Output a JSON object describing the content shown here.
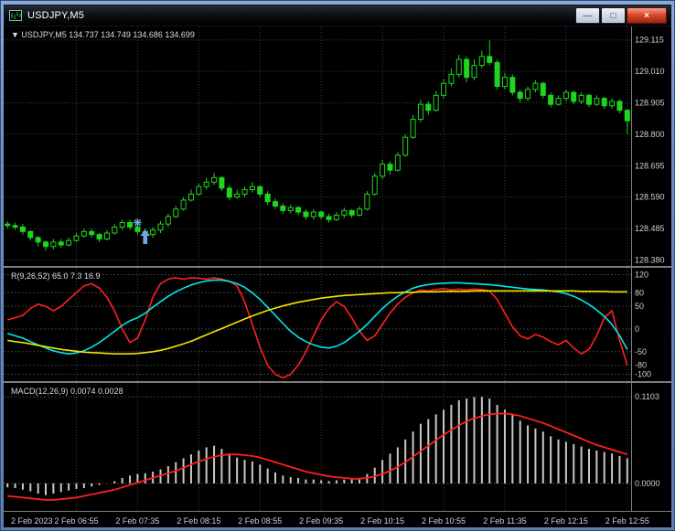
{
  "window": {
    "title": "USDJPY,M5",
    "buttons": [
      {
        "name": "Minimize",
        "glyph": "—"
      },
      {
        "name": "Maximize",
        "glyph": "□"
      },
      {
        "name": "Close",
        "glyph": "×"
      }
    ]
  },
  "colors": {
    "bg": "#000000",
    "grid": "#2d4444",
    "level": "#3c3c3c",
    "text": "#cfcfcf",
    "separator": "#808080",
    "candle": "#1fd51f"
  },
  "chart_data": [
    {
      "type": "candlestick",
      "symbol": "USDJPY",
      "timeframe": "M5",
      "header": "▼ USDJPY,M5 134.737 134.749 134.686 134.699",
      "price_axis": [
        "129.115",
        "129.010",
        "128.905",
        "128.800",
        "128.695",
        "128.590",
        "128.485",
        "128.380"
      ],
      "y_range": [
        128.36,
        129.16
      ],
      "annotation_color": "#6fa8dc",
      "annotations": [
        {
          "type": "star",
          "bar": 17,
          "price": 128.505
        },
        {
          "type": "arrow-up",
          "bar": 18,
          "price": 128.482
        }
      ],
      "candles": [
        [
          128.5,
          128.51,
          128.485,
          128.495
        ],
        [
          128.495,
          128.505,
          128.48,
          128.49
        ],
        [
          128.49,
          128.5,
          128.465,
          128.475
        ],
        [
          128.475,
          128.48,
          128.445,
          128.455
        ],
        [
          128.455,
          128.46,
          128.425,
          128.44
        ],
        [
          128.44,
          128.445,
          128.41,
          128.425
        ],
        [
          128.425,
          128.45,
          128.415,
          128.44
        ],
        [
          128.44,
          128.45,
          128.42,
          128.43
        ],
        [
          128.43,
          128.455,
          128.425,
          128.445
        ],
        [
          128.445,
          128.47,
          128.44,
          128.46
        ],
        [
          128.46,
          128.485,
          128.455,
          128.475
        ],
        [
          128.475,
          128.485,
          128.455,
          128.465
        ],
        [
          128.465,
          128.47,
          128.44,
          128.45
        ],
        [
          128.45,
          128.48,
          128.445,
          128.47
        ],
        [
          128.47,
          128.5,
          128.465,
          128.49
        ],
        [
          128.49,
          128.515,
          128.48,
          128.505
        ],
        [
          128.505,
          128.515,
          128.48,
          128.49
        ],
        [
          128.49,
          128.5,
          128.465,
          128.475
        ],
        [
          128.475,
          128.485,
          128.45,
          128.465
        ],
        [
          128.465,
          128.49,
          128.455,
          128.48
        ],
        [
          128.48,
          128.51,
          128.47,
          128.5
        ],
        [
          128.5,
          128.535,
          128.49,
          128.525
        ],
        [
          128.525,
          128.56,
          128.52,
          128.55
        ],
        [
          128.55,
          128.59,
          128.545,
          128.58
        ],
        [
          128.58,
          128.615,
          128.575,
          128.6
        ],
        [
          128.6,
          128.635,
          128.595,
          128.625
        ],
        [
          128.625,
          128.655,
          128.615,
          128.64
        ],
        [
          128.64,
          128.67,
          128.63,
          128.655
        ],
        [
          128.655,
          128.66,
          128.61,
          128.62
        ],
        [
          128.62,
          128.63,
          128.58,
          128.59
        ],
        [
          128.59,
          128.615,
          128.585,
          128.6
        ],
        [
          128.6,
          128.625,
          128.59,
          128.615
        ],
        [
          128.615,
          128.64,
          128.605,
          128.625
        ],
        [
          128.625,
          128.63,
          128.59,
          128.6
        ],
        [
          128.6,
          128.61,
          128.565,
          128.575
        ],
        [
          128.575,
          128.585,
          128.55,
          128.56
        ],
        [
          128.56,
          128.57,
          128.535,
          128.545
        ],
        [
          128.545,
          128.565,
          128.535,
          128.555
        ],
        [
          128.555,
          128.56,
          128.53,
          128.54
        ],
        [
          128.54,
          128.55,
          128.515,
          128.525
        ],
        [
          128.525,
          128.55,
          128.515,
          128.54
        ],
        [
          128.54,
          128.545,
          128.515,
          128.525
        ],
        [
          128.525,
          128.535,
          128.505,
          128.515
        ],
        [
          128.515,
          128.54,
          128.51,
          128.53
        ],
        [
          128.53,
          128.555,
          128.52,
          128.545
        ],
        [
          128.545,
          128.55,
          128.52,
          128.53
        ],
        [
          128.53,
          128.56,
          128.525,
          128.55
        ],
        [
          128.55,
          128.61,
          128.545,
          128.6
        ],
        [
          128.6,
          128.67,
          128.595,
          128.66
        ],
        [
          128.66,
          128.715,
          128.65,
          128.7
        ],
        [
          128.7,
          128.71,
          128.665,
          128.68
        ],
        [
          128.68,
          128.74,
          128.675,
          128.73
        ],
        [
          128.73,
          128.8,
          128.725,
          128.79
        ],
        [
          128.79,
          128.865,
          128.785,
          128.85
        ],
        [
          128.85,
          128.915,
          128.84,
          128.9
        ],
        [
          128.9,
          128.91,
          128.865,
          128.88
        ],
        [
          128.88,
          128.945,
          128.875,
          128.93
        ],
        [
          128.93,
          128.985,
          128.92,
          128.97
        ],
        [
          128.97,
          129.02,
          128.96,
          129.0
        ],
        [
          129.0,
          129.065,
          128.99,
          129.05
        ],
        [
          129.05,
          129.06,
          128.975,
          128.99
        ],
        [
          128.99,
          129.05,
          128.98,
          129.03
        ],
        [
          129.03,
          129.08,
          129.02,
          129.06
        ],
        [
          129.06,
          129.115,
          129.03,
          129.04
        ],
        [
          129.04,
          129.05,
          128.95,
          128.96
        ],
        [
          128.96,
          129.005,
          128.95,
          128.99
        ],
        [
          128.99,
          129.0,
          128.93,
          128.94
        ],
        [
          128.94,
          128.95,
          128.905,
          128.92
        ],
        [
          128.92,
          128.96,
          128.91,
          128.95
        ],
        [
          128.95,
          128.98,
          128.94,
          128.97
        ],
        [
          128.97,
          128.975,
          128.92,
          128.93
        ],
        [
          128.93,
          128.94,
          128.89,
          128.9
        ],
        [
          128.9,
          128.93,
          128.895,
          128.92
        ],
        [
          128.92,
          128.95,
          128.91,
          128.94
        ],
        [
          128.94,
          128.945,
          128.9,
          128.91
        ],
        [
          128.91,
          128.94,
          128.9,
          128.93
        ],
        [
          128.93,
          128.935,
          128.89,
          128.9
        ],
        [
          128.9,
          128.93,
          128.895,
          128.92
        ],
        [
          128.92,
          128.925,
          128.885,
          128.895
        ],
        [
          128.895,
          128.92,
          128.885,
          128.91
        ],
        [
          128.91,
          128.915,
          128.87,
          128.88
        ],
        [
          128.88,
          128.885,
          128.8,
          128.845
        ]
      ]
    },
    {
      "type": "line",
      "label": "R(9,26,52) 65.0 7.3 16.9",
      "y_range": [
        -115,
        135
      ],
      "levels": [
        120,
        80,
        50,
        0,
        -50,
        -80,
        -100
      ],
      "series": [
        {
          "name": "fast-red",
          "color": "#ff2020",
          "values": [
            20,
            25,
            30,
            45,
            55,
            50,
            40,
            50,
            65,
            80,
            95,
            100,
            90,
            70,
            40,
            0,
            -30,
            -20,
            20,
            70,
            100,
            110,
            113,
            110,
            113,
            112,
            110,
            113,
            110,
            105,
            95,
            60,
            10,
            -40,
            -80,
            -100,
            -108,
            -100,
            -80,
            -50,
            -15,
            20,
            45,
            60,
            50,
            25,
            -5,
            -25,
            -15,
            10,
            35,
            55,
            70,
            80,
            86,
            84,
            87,
            89,
            86,
            88,
            86,
            88,
            87,
            84,
            65,
            35,
            5,
            -15,
            -22,
            -12,
            -18,
            -28,
            -35,
            -25,
            -42,
            -55,
            -45,
            -15,
            25,
            40,
            -25,
            -80
          ]
        },
        {
          "name": "mid-cyan",
          "color": "#00e8e8",
          "values": [
            -10,
            -15,
            -20,
            -28,
            -35,
            -42,
            -48,
            -52,
            -55,
            -53,
            -48,
            -40,
            -30,
            -18,
            -5,
            8,
            18,
            25,
            35,
            48,
            60,
            72,
            82,
            90,
            97,
            102,
            106,
            108,
            108,
            105,
            100,
            92,
            80,
            65,
            48,
            30,
            12,
            -5,
            -18,
            -28,
            -35,
            -40,
            -42,
            -38,
            -30,
            -18,
            -5,
            10,
            28,
            45,
            60,
            72,
            82,
            90,
            95,
            98,
            100,
            101,
            102,
            102,
            101,
            100,
            99,
            98,
            96,
            94,
            92,
            90,
            88,
            87,
            86,
            84,
            82,
            78,
            72,
            64,
            54,
            42,
            28,
            10,
            -15,
            -45
          ]
        },
        {
          "name": "slow-yellow",
          "color": "#f2e400",
          "values": [
            -25,
            -28,
            -30,
            -33,
            -36,
            -39,
            -42,
            -45,
            -47,
            -49,
            -51,
            -52,
            -53,
            -54,
            -55,
            -55,
            -55,
            -54,
            -52,
            -50,
            -47,
            -43,
            -38,
            -33,
            -27,
            -20,
            -13,
            -6,
            1,
            8,
            15,
            22,
            29,
            35,
            41,
            46,
            51,
            55,
            59,
            62,
            65,
            68,
            70,
            72,
            74,
            75,
            76,
            77,
            78,
            79,
            80,
            80,
            81,
            81,
            82,
            82,
            82,
            83,
            83,
            83,
            83,
            84,
            84,
            84,
            84,
            84,
            84,
            84,
            84,
            84,
            84,
            84,
            84,
            84,
            84,
            83,
            83,
            83,
            83,
            82,
            82,
            82
          ]
        }
      ]
    },
    {
      "type": "macd",
      "label": "MACD(12,26,9) 0.0074 0.0028",
      "y_range": [
        -0.035,
        0.128
      ],
      "axis_labels": [
        {
          "text": "0.1103",
          "value": 0.1103
        },
        {
          "text": "0.0000",
          "value": 0.0
        }
      ],
      "histogram_color": "#c8c8c8",
      "signal_color": "#ff2020",
      "histogram": [
        -0.005,
        -0.006,
        -0.008,
        -0.01,
        -0.013,
        -0.015,
        -0.013,
        -0.011,
        -0.009,
        -0.007,
        -0.006,
        -0.004,
        -0.002,
        0.0,
        0.003,
        0.007,
        0.01,
        0.012,
        0.013,
        0.015,
        0.018,
        0.022,
        0.027,
        0.032,
        0.037,
        0.042,
        0.046,
        0.048,
        0.044,
        0.038,
        0.033,
        0.03,
        0.028,
        0.024,
        0.019,
        0.014,
        0.01,
        0.008,
        0.007,
        0.005,
        0.005,
        0.004,
        0.003,
        0.004,
        0.005,
        0.005,
        0.007,
        0.012,
        0.02,
        0.03,
        0.038,
        0.046,
        0.056,
        0.066,
        0.076,
        0.082,
        0.088,
        0.094,
        0.1,
        0.106,
        0.108,
        0.11,
        0.1103,
        0.108,
        0.1,
        0.094,
        0.088,
        0.08,
        0.074,
        0.07,
        0.066,
        0.06,
        0.056,
        0.053,
        0.05,
        0.047,
        0.044,
        0.042,
        0.04,
        0.038,
        0.035,
        0.032
      ],
      "signal": [
        -0.016,
        -0.017,
        -0.018,
        -0.019,
        -0.02,
        -0.021,
        -0.021,
        -0.02,
        -0.019,
        -0.018,
        -0.016,
        -0.014,
        -0.012,
        -0.01,
        -0.008,
        -0.005,
        -0.002,
        0.001,
        0.004,
        0.007,
        0.01,
        0.013,
        0.016,
        0.02,
        0.024,
        0.028,
        0.031,
        0.034,
        0.036,
        0.037,
        0.037,
        0.036,
        0.035,
        0.033,
        0.03,
        0.027,
        0.024,
        0.021,
        0.018,
        0.015,
        0.013,
        0.011,
        0.009,
        0.008,
        0.007,
        0.006,
        0.006,
        0.007,
        0.009,
        0.012,
        0.016,
        0.021,
        0.027,
        0.034,
        0.041,
        0.048,
        0.055,
        0.062,
        0.068,
        0.074,
        0.079,
        0.083,
        0.086,
        0.088,
        0.089,
        0.089,
        0.088,
        0.086,
        0.083,
        0.08,
        0.077,
        0.073,
        0.069,
        0.065,
        0.061,
        0.057,
        0.053,
        0.049,
        0.046,
        0.043,
        0.04,
        0.037
      ]
    }
  ],
  "time_axis": {
    "labels": [
      {
        "text": "2 Feb 2023",
        "bar": 0,
        "align": "left"
      },
      {
        "text": "2 Feb 06:55",
        "bar": 9
      },
      {
        "text": "2 Feb 07:35",
        "bar": 17
      },
      {
        "text": "2 Feb 08:15",
        "bar": 25
      },
      {
        "text": "2 Feb 08:55",
        "bar": 33
      },
      {
        "text": "2 Feb 09:35",
        "bar": 41
      },
      {
        "text": "2 Feb 10:15",
        "bar": 49
      },
      {
        "text": "2 Feb 10:55",
        "bar": 57
      },
      {
        "text": "2 Feb 11:35",
        "bar": 65
      },
      {
        "text": "2 Feb 12:15",
        "bar": 73
      },
      {
        "text": "2 Feb 12:55",
        "bar": 81
      }
    ]
  }
}
